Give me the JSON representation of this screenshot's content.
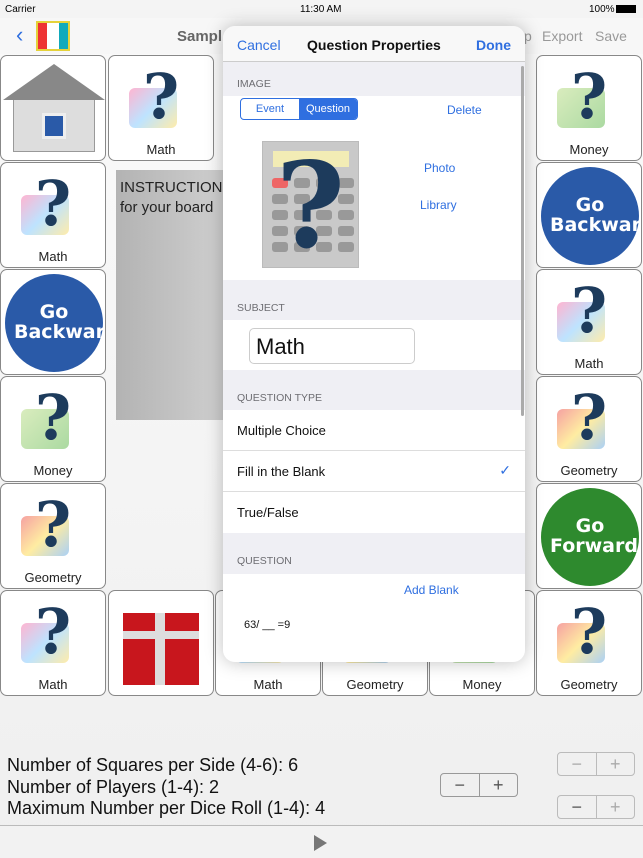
{
  "status": {
    "carrier": "Carrier",
    "time": "11:30 AM",
    "battery": "100%"
  },
  "nav": {
    "title": "Sampl",
    "actions": [
      "p",
      "Export",
      "Save"
    ]
  },
  "board": {
    "tiles": [
      {
        "label": "",
        "icon": "home-icon"
      },
      {
        "label": "Math",
        "icon": "math-question-icon"
      },
      {
        "label": "Money",
        "icon": "money-question-icon"
      },
      {
        "label": "Math",
        "icon": "math-question-icon"
      },
      {
        "label": "Go Backward",
        "icon": "go-backward-icon"
      },
      {
        "label": "Go Backward",
        "icon": "go-backward-icon"
      },
      {
        "label": "Math",
        "icon": "math-question-icon"
      },
      {
        "label": "Money",
        "icon": "money-question-icon"
      },
      {
        "label": "Geometry",
        "icon": "geometry-question-icon"
      },
      {
        "label": "Geometry",
        "icon": "geometry-question-icon"
      },
      {
        "label": "Go Forward",
        "icon": "go-forward-icon"
      },
      {
        "label": "Math",
        "icon": "math-question-icon"
      },
      {
        "label": "",
        "icon": "gift-icon"
      },
      {
        "label": "Math",
        "icon": "math-question-icon"
      },
      {
        "label": "Geometry",
        "icon": "geometry-question-icon"
      },
      {
        "label": "Money",
        "icon": "money-question-icon"
      },
      {
        "label": "Geometry",
        "icon": "geometry-question-icon"
      }
    ],
    "instructions": [
      "INSTRUCTION",
      "for your board"
    ],
    "colors": {
      "backward": "#2a5aa8",
      "forward": "#2e8a2e"
    }
  },
  "popover": {
    "cancel": "Cancel",
    "title": "Question Properties",
    "done": "Done",
    "image_header": "IMAGE",
    "segments": [
      "Event",
      "Question"
    ],
    "selected_segment": "Question",
    "delete": "Delete",
    "photo": "Photo",
    "library": "Library",
    "subject_header": "SUBJECT",
    "subject_value": "Math",
    "qtype_header": "QUESTION TYPE",
    "qtypes": [
      "Multiple Choice",
      "Fill in the Blank",
      "True/False"
    ],
    "selected_qtype": "Fill in the Blank",
    "question_header": "QUESTION",
    "add_blank": "Add Blank",
    "question_text": "63/ __ =9"
  },
  "settings": [
    {
      "label": "Number of Squares per Side (4-6): 6"
    },
    {
      "label": "Number of Players (1-4): 2"
    },
    {
      "label": "Maximum Number per Dice Roll (1-4): 4"
    }
  ],
  "stepper": {
    "minus": "−",
    "plus": "+"
  }
}
